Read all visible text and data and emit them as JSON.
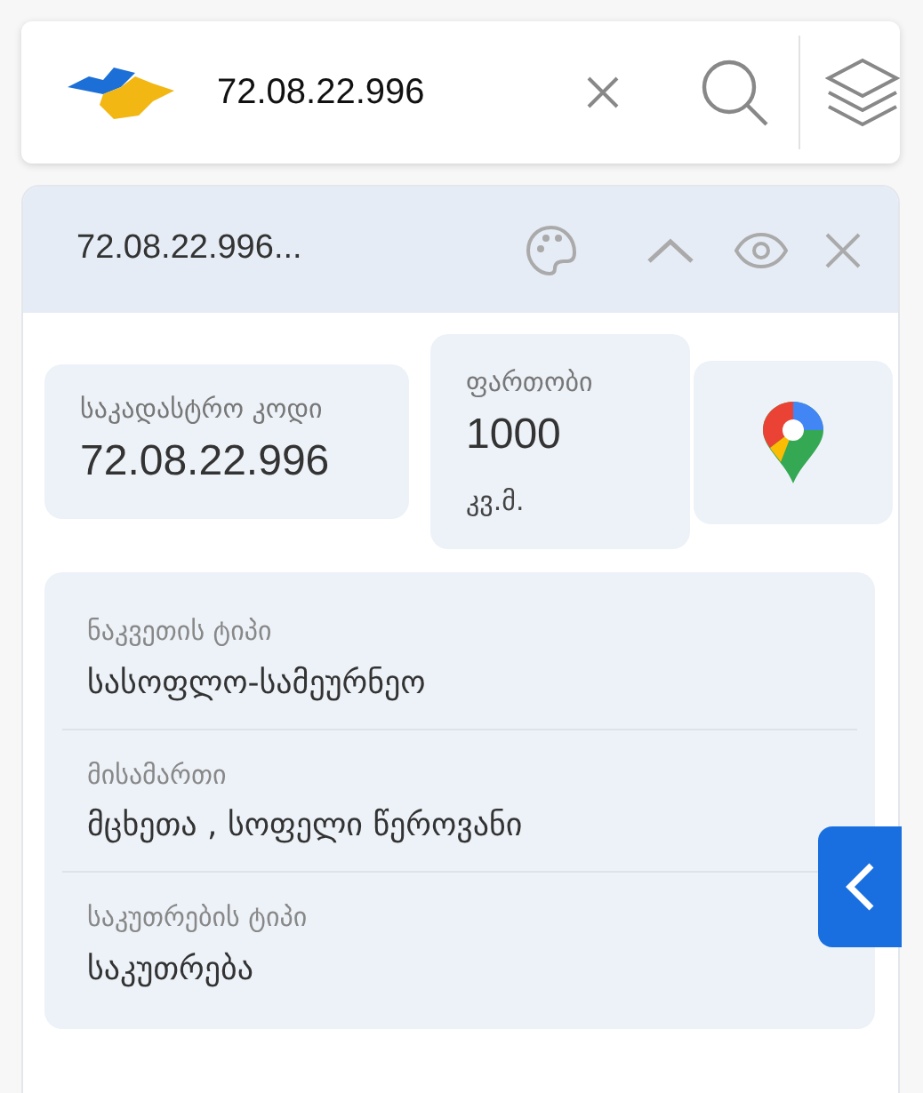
{
  "search": {
    "value": "72.08.22.996"
  },
  "result": {
    "title": "72.08.22.996...",
    "tiles": [
      {
        "kind": "text",
        "label": "საკადასტრო კოდი",
        "value": "72.08.22.996"
      },
      {
        "kind": "area",
        "label": "ფართობი",
        "value": "1000",
        "unit": "კვ.მ."
      },
      {
        "kind": "map"
      }
    ],
    "details": [
      {
        "label": "ნაკვეთის ტიპი",
        "value": "სასოფლო-სამეურნეო"
      },
      {
        "label": "მისამართი",
        "value": "მცხეთა , სოფელი წეროვანი"
      },
      {
        "label": "საკუთრების ტიპი",
        "value": "საკუთრება"
      }
    ]
  }
}
